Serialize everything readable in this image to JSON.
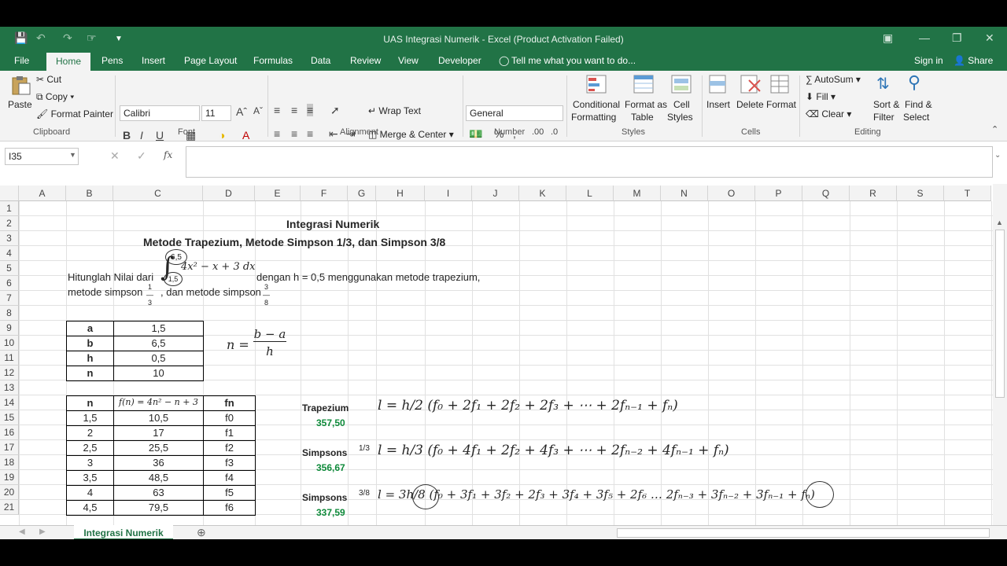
{
  "window": {
    "title": "UAS Integrasi Numerik - Excel (Product Activation Failed)"
  },
  "tabs": [
    "File",
    "Home",
    "Pens",
    "Insert",
    "Page Layout",
    "Formulas",
    "Data",
    "Review",
    "View",
    "Developer"
  ],
  "tell_me": "Tell me what you want to do...",
  "sign_in": "Sign in",
  "share": "Share",
  "clipboard": {
    "paste": "Paste",
    "cut": "Cut",
    "copy": "Copy",
    "format_painter": "Format Painter",
    "group": "Clipboard"
  },
  "font": {
    "name": "Calibri",
    "size": "11",
    "group": "Font"
  },
  "alignment": {
    "wrap": "Wrap Text",
    "merge": "Merge & Center",
    "group": "Alignment"
  },
  "number": {
    "format": "General",
    "group": "Number"
  },
  "styles": {
    "conditional": "Conditional",
    "conditional2": "Formatting",
    "format_as": "Format as",
    "format_as2": "Table",
    "cell": "Cell",
    "cell2": "Styles",
    "group": "Styles"
  },
  "cells": {
    "insert": "Insert",
    "delete": "Delete",
    "format": "Format",
    "group": "Cells"
  },
  "editing": {
    "autosum": "AutoSum",
    "fill": "Fill",
    "clear": "Clear",
    "sort": "Sort &",
    "sort2": "Filter",
    "find": "Find &",
    "find2": "Select",
    "group": "Editing"
  },
  "name_box": "I35",
  "fx": "fx",
  "columns": [
    "A",
    "B",
    "C",
    "D",
    "E",
    "F",
    "G",
    "H",
    "I",
    "J",
    "K",
    "L",
    "M",
    "N",
    "O",
    "P",
    "Q",
    "R",
    "S",
    "T"
  ],
  "rows": [
    "1",
    "2",
    "3",
    "4",
    "5",
    "6",
    "7",
    "8",
    "9",
    "10",
    "11",
    "12",
    "13",
    "14",
    "15",
    "16",
    "17",
    "18",
    "19",
    "20",
    "21"
  ],
  "sheet": {
    "title": "Integrasi Numerik",
    "subtitle": "Metode Trapezium, Metode Simpson 1/3, dan Simpson 3/8",
    "q1": "Hitunglah Nilai dari",
    "q1b": "dengan h = 0,5 menggunakan metode trapezium,",
    "q2": "metode simpson",
    "q2b": ", dan metode simpson",
    "upper": "6,5",
    "lower": "1,5",
    "integrand": "4x² − x + 3 dx",
    "params": [
      [
        "a",
        "1,5"
      ],
      [
        "b",
        "6,5"
      ],
      [
        "h",
        "0,5"
      ],
      [
        "n",
        "10"
      ]
    ],
    "n_formula_lhs": "n =",
    "n_formula_num": "b − a",
    "n_formula_den": "h",
    "table_head": [
      "n",
      "f(n) = 4n² − n + 3",
      "fn"
    ],
    "table_rows": [
      [
        "1,5",
        "10,5",
        "f0"
      ],
      [
        "2",
        "17",
        "f1"
      ],
      [
        "2,5",
        "25,5",
        "f2"
      ],
      [
        "3",
        "36",
        "f3"
      ],
      [
        "3,5",
        "48,5",
        "f4"
      ],
      [
        "4",
        "63",
        "f5"
      ],
      [
        "4,5",
        "79,5",
        "f6"
      ]
    ],
    "trapezium_label": "Trapezium",
    "trapezium_value": "357,50",
    "trapezium_formula": "l = h/2 (f₀ + 2f₁ + 2f₂ + 2f₃ + ⋯ + 2fₙ₋₁ + fₙ)",
    "simpson13_label": "Simpsons",
    "simpson13_frac": "1/3",
    "simpson13_value": "356,67",
    "simpson13_formula": "l = h/3 (f₀ + 4f₁ + 2f₂ + 4f₃ + ⋯ + 2fₙ₋₂ + 4fₙ₋₁ + fₙ)",
    "simpson38_label": "Simpsons",
    "simpson38_frac": "3/8",
    "simpson38_value": "337,59",
    "simpson38_formula": "l = 3h/8 (f₀ + 3f₁ + 3f₂ + 2f₃ + 3f₄ + 3f₅ + 2f₆ … 2fₙ₋₃ + 3fₙ₋₂ + 3fₙ₋₁ + fₙ)"
  },
  "sheet_tab": "Integrasi Numerik",
  "colors": {
    "brand": "#217346",
    "value_green": "#0e8a3a"
  }
}
